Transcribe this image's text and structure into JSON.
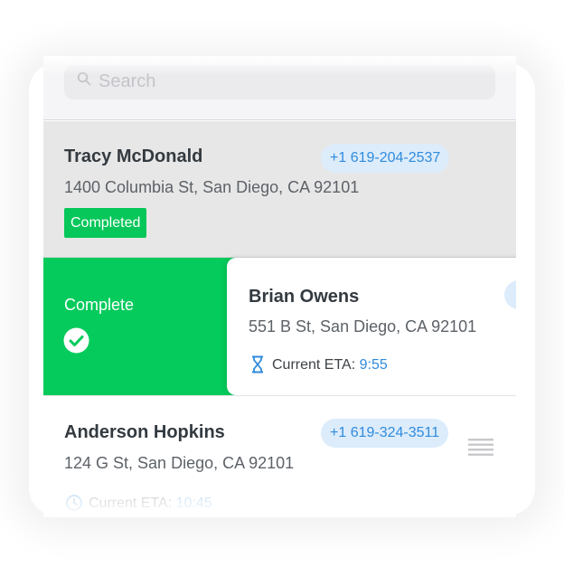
{
  "search": {
    "placeholder": "Search"
  },
  "stops": [
    {
      "name": "Tracy McDonald",
      "phone": "+1 619-204-2537",
      "address": "1400 Columbia St, San Diego, CA 92101",
      "status": "Completed"
    },
    {
      "name": "Brian Owens",
      "address": "551 B St, San Diego, CA 92101",
      "eta_label": "Current ETA: ",
      "eta_time": "9:55",
      "swipe_action": "Complete"
    },
    {
      "name": "Anderson Hopkins",
      "phone": "+1 619-324-3511",
      "address": "124 G St, San Diego, CA 92101",
      "eta_label": "Current ETA: ",
      "eta_time": "10:45"
    }
  ],
  "colors": {
    "accent_blue": "#2f8bdd",
    "pill_blue_bg": "#dcecfb",
    "success_green": "#04cb5c",
    "completed_row_bg": "#e7e7e7"
  },
  "icons": {
    "search": "search-icon",
    "check": "check-circle-icon",
    "hourglass": "hourglass-icon",
    "clock": "clock-icon",
    "drag": "drag-handle-icon"
  }
}
